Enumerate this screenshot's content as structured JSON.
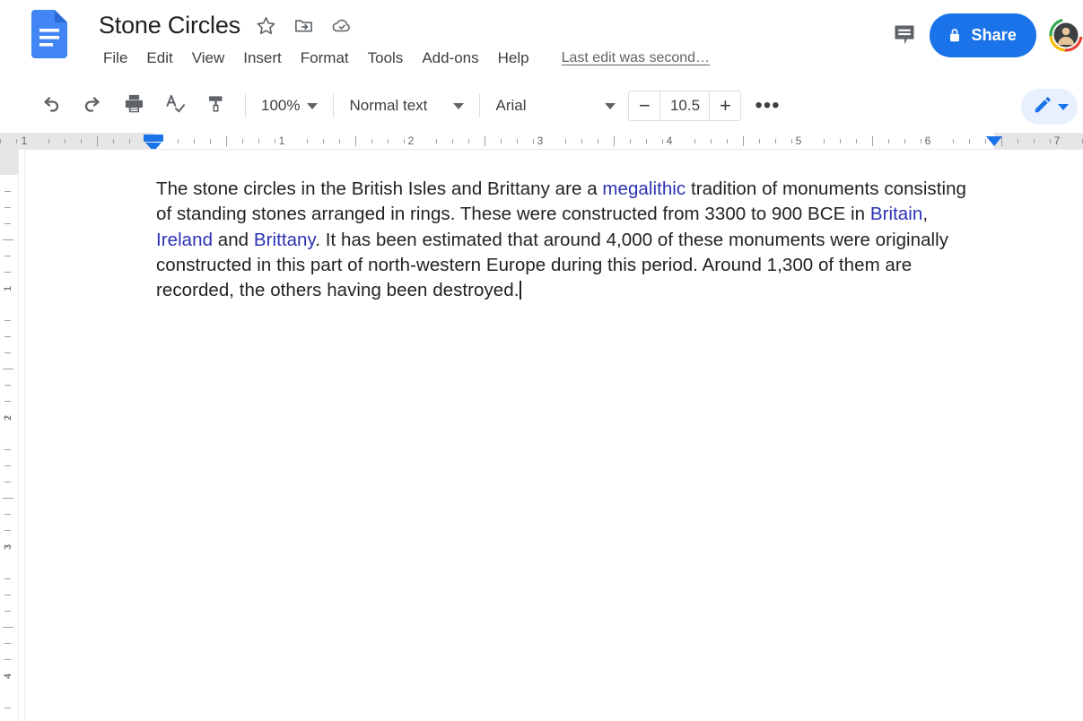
{
  "app": {
    "name": "Google Docs",
    "logo_icon": "docs-document-icon",
    "accent_color": "#1a73e8",
    "text_color": "#3c4043"
  },
  "header": {
    "doc_title": "Stone Circles",
    "title_icons": [
      {
        "name": "star-icon",
        "label": "Star"
      },
      {
        "name": "move-to-folder-icon",
        "label": "Move"
      },
      {
        "name": "cloud-saved-icon",
        "label": "Saved to Drive"
      }
    ],
    "menus": [
      {
        "label": "File"
      },
      {
        "label": "Edit"
      },
      {
        "label": "View"
      },
      {
        "label": "Insert"
      },
      {
        "label": "Format"
      },
      {
        "label": "Tools"
      },
      {
        "label": "Add-ons"
      },
      {
        "label": "Help"
      }
    ],
    "last_edit": "Last edit was second…",
    "comment_icon": "comment-bubble-icon",
    "share_label": "Share",
    "share_icon": "lock-icon",
    "avatar": "user-avatar"
  },
  "toolbar": {
    "buttons": [
      {
        "name": "undo-button",
        "icon": "undo-icon"
      },
      {
        "name": "redo-button",
        "icon": "redo-icon"
      },
      {
        "name": "print-button",
        "icon": "print-icon"
      },
      {
        "name": "spelling-button",
        "icon": "spellcheck-icon"
      },
      {
        "name": "paint-format-button",
        "icon": "paint-format-icon"
      }
    ],
    "zoom_value": "100%",
    "style_value": "Normal text",
    "font_value": "Arial",
    "font_size_value": "10.5",
    "font_size_decrease": "−",
    "font_size_increase": "+",
    "more_label": "•••",
    "mode_icon": "pencil-edit-icon"
  },
  "ruler": {
    "horizontal_numbers": [
      "1",
      "1",
      "2",
      "3",
      "4",
      "5",
      "6",
      "7"
    ],
    "vertical_numbers": [
      "1",
      "2",
      "3",
      "4"
    ],
    "left_indent_icon": "left-indent-marker",
    "right_indent_icon": "right-indent-marker"
  },
  "document": {
    "paragraph": {
      "segments": [
        {
          "text": "The stone circles in the British Isles and Brittany are a ",
          "link": false
        },
        {
          "text": "megalithic",
          "link": true
        },
        {
          "text": " tradition of monuments consisting of standing stones arranged in rings. These were constructed from 3300 to 900 BCE in ",
          "link": false
        },
        {
          "text": "Britain",
          "link": true
        },
        {
          "text": ", ",
          "link": false
        },
        {
          "text": "Ireland",
          "link": true
        },
        {
          "text": " and ",
          "link": false
        },
        {
          "text": "Brittany",
          "link": true
        },
        {
          "text": ". It has been estimated that around 4,000 of these monuments were originally constructed in this part of north-western Europe during this period. Around 1,300 of them are recorded, the others having been destroyed.",
          "link": false
        }
      ],
      "link_color": "#2b31b3",
      "text_color": "#222222"
    },
    "caret_visible": true
  }
}
